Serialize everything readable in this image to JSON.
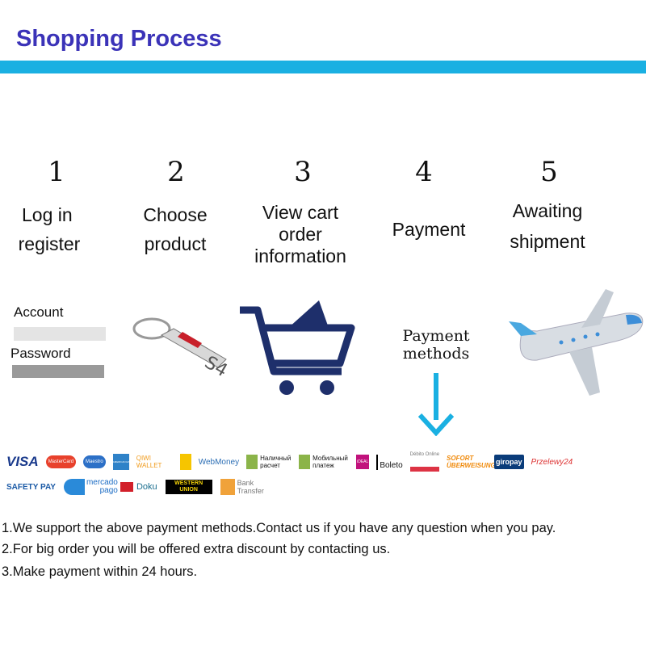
{
  "title": "Shopping Process",
  "steps": [
    {
      "number": "1",
      "label": [
        "Log in",
        "register"
      ]
    },
    {
      "number": "2",
      "label": [
        "Choose",
        "product"
      ]
    },
    {
      "number": "3",
      "label": [
        "View cart",
        "order",
        "information"
      ]
    },
    {
      "number": "4",
      "label": [
        "Payment"
      ]
    },
    {
      "number": "5",
      "label": [
        "Awaiting",
        "shipment"
      ]
    }
  ],
  "login_graphic": {
    "account": "Account",
    "password": "Password"
  },
  "payment_graphic": {
    "line1": "Payment",
    "line2": "methods"
  },
  "payment_logos": {
    "row1": [
      "VISA",
      "MasterCard",
      "Maestro",
      "AMERICAN EXPRESS",
      "QIWI WALLET",
      "",
      "WebMoney",
      "Наличный расчет",
      "Мобильный платеж",
      "iDEAL",
      "Boleto",
      "Débito Online",
      "SOFORT ÜBERWEISUNG",
      "giropay",
      "Przelewy24"
    ],
    "row2": [
      "SAFETY PAY",
      "mercado pago",
      "Doku",
      "WESTERN UNION",
      "Bank Transfer"
    ]
  },
  "colors": {
    "title": "#3b33b8",
    "bar": "#1ab0e2",
    "cart": "#1e2f6b",
    "arrow": "#1ab0e2"
  },
  "notes": [
    "1.We support the above payment methods.Contact us if you have any question when you pay.",
    "2.For big order you will be offered extra discount by contacting us.",
    "3.Make payment within 24 hours."
  ]
}
